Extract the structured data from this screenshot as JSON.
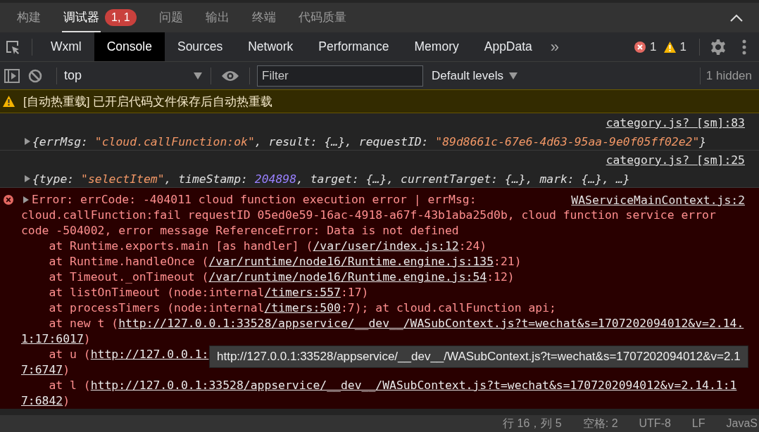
{
  "top_panel": {
    "tabs": [
      {
        "label": "构建",
        "selected": false
      },
      {
        "label": "调试器",
        "selected": true,
        "badge": "1, 1"
      },
      {
        "label": "问题",
        "selected": false
      },
      {
        "label": "输出",
        "selected": false
      },
      {
        "label": "终端",
        "selected": false
      },
      {
        "label": "代码质量",
        "selected": false
      }
    ]
  },
  "devtools": {
    "tabs": [
      {
        "label": "Wxml",
        "selected": false
      },
      {
        "label": "Console",
        "selected": true
      },
      {
        "label": "Sources",
        "selected": false
      },
      {
        "label": "Network",
        "selected": false
      },
      {
        "label": "Performance",
        "selected": false
      },
      {
        "label": "Memory",
        "selected": false
      },
      {
        "label": "AppData",
        "selected": false
      }
    ],
    "more": "»",
    "error_count": "1",
    "warning_count": "1"
  },
  "toolbar": {
    "context": "top",
    "filter": {
      "placeholder": "Filter"
    },
    "levels": "Default levels",
    "hidden": "1 hidden"
  },
  "console": {
    "messages": [
      {
        "kind": "warning",
        "text": "[自动热重载] 已开启代码文件保存后自动热重载"
      },
      {
        "kind": "log",
        "source": "category.js? [sm]:83",
        "expanded": false,
        "tokens": [
          {
            "kind": "plain",
            "text": "{errMsg: "
          },
          {
            "kind": "string",
            "text": "\"cloud.callFunction:ok\""
          },
          {
            "kind": "plain",
            "text": ", result: {…}, requestID: "
          },
          {
            "kind": "string",
            "text": "\"89d8661c-67e6-4d63-95aa-9e0f05ff02e2\""
          },
          {
            "kind": "plain",
            "text": "}"
          }
        ]
      },
      {
        "kind": "log",
        "source": "category.js? [sm]:25",
        "expanded": false,
        "tokens": [
          {
            "kind": "plain",
            "text": "{type: "
          },
          {
            "kind": "string",
            "text": "\"selectItem\""
          },
          {
            "kind": "plain",
            "text": ", timeStamp: "
          },
          {
            "kind": "number",
            "text": "204898"
          },
          {
            "kind": "plain",
            "text": ", target: {…}, currentTarget: {…}, mark: {…}, …}"
          }
        ]
      },
      {
        "kind": "error",
        "source": "WAServiceMainContext.js:2",
        "expanded": false,
        "lines": [
          [
            {
              "text": "Error: errCode: -404011 cloud function execution error | errMsg:",
              "link": false
            }
          ],
          [
            {
              "text": "cloud.callFunction:fail requestID 05ed0e59-16ac-4918-a67f-43b1aba25d0b, cloud function service error",
              "link": false
            }
          ],
          [
            {
              "text": "code -504002, error message ReferenceError: Data is not defined",
              "link": false
            }
          ],
          [
            {
              "text": "    at Runtime.exports.main [as handler] (",
              "link": false
            },
            {
              "text": "/var/user/index.js:12",
              "link": true
            },
            {
              "text": ":24)",
              "link": false
            }
          ],
          [
            {
              "text": "    at Runtime.handleOnce (",
              "link": false
            },
            {
              "text": "/var/runtime/node16/Runtime.engine.js:135",
              "link": true
            },
            {
              "text": ":21)",
              "link": false
            }
          ],
          [
            {
              "text": "    at Timeout._onTimeout (",
              "link": false
            },
            {
              "text": "/var/runtime/node16/Runtime.engine.js:54",
              "link": true
            },
            {
              "text": ":12)",
              "link": false
            }
          ],
          [
            {
              "text": "    at listOnTimeout (node:internal",
              "link": false
            },
            {
              "text": "/timers:557",
              "link": true
            },
            {
              "text": ":17)",
              "link": false
            }
          ],
          [
            {
              "text": "    at processTimers (node:internal",
              "link": false
            },
            {
              "text": "/timers:500",
              "link": true
            },
            {
              "text": ":7); at cloud.callFunction api;",
              "link": false
            }
          ],
          [
            {
              "text": "    at new t (",
              "link": false
            },
            {
              "text": "http://127.0.0.1:33528/appservice/__dev__/WASubContext.js?t=wechat&s=1707202094012&v=2.14.",
              "link": true
            }
          ],
          [
            {
              "text": "1:17:6017",
              "link": true
            },
            {
              "text": ")",
              "link": false
            }
          ],
          [
            {
              "text": "    at u (",
              "link": false
            },
            {
              "text": "http://127.0.0.1:",
              "link": true
            }
          ],
          [
            {
              "text": "7:6747",
              "link": true
            },
            {
              "text": ")",
              "link": false
            }
          ],
          [
            {
              "text": "    at l (",
              "link": false
            },
            {
              "text": "http://127.0.0.1:33528/appservice/__dev__/WASubContext.js?t=wechat&s=1707202094012&v=2.14.1:1",
              "link": true
            }
          ],
          [
            {
              "text": "7:6842",
              "link": true
            },
            {
              "text": ")",
              "link": false
            }
          ]
        ]
      }
    ]
  },
  "tooltip": {
    "text": "http://127.0.0.1:33528/appservice/__dev__/WASubContext.js?t=wechat&s=1707202094012&v=2.1"
  },
  "status_bar": {
    "items": [
      "行 16，列 5",
      "空格: 2",
      "UTF-8",
      "LF",
      "JavaS"
    ]
  }
}
